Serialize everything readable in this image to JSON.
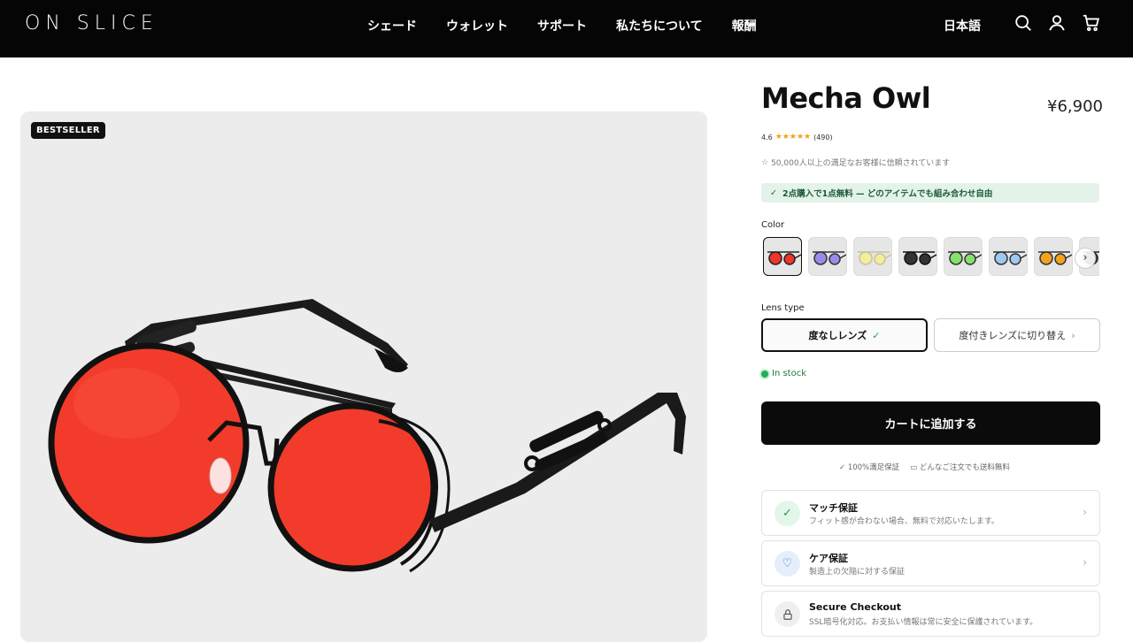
{
  "nav": {
    "logo": "ON SLICE",
    "links": [
      "シェード",
      "ウォレット",
      "サポート",
      "私たちについて",
      "報酬"
    ],
    "language": "日本語",
    "icons": [
      "search-icon",
      "account-icon",
      "cart-icon"
    ]
  },
  "gallery": {
    "badge": "BESTSELLER",
    "lens_color": "#f23b2a"
  },
  "product": {
    "title": "Mecha Owl",
    "price": "¥6,900",
    "rating": "4.6",
    "stars": "★★★★★",
    "review_count": "(490)",
    "trust": "50,000人以上の満足なお客様に信頼されています",
    "promo": "2点購入で1点無料 — どのアイテムでも組み合わせ自由",
    "color_label": "Color",
    "swatches": [
      {
        "lens": "#f0352a",
        "frame": "#222"
      },
      {
        "lens": "#9b8be8",
        "frame": "#333"
      },
      {
        "lens": "#f2ee9a",
        "frame": "#c9c1a0"
      },
      {
        "lens": "#333333",
        "frame": "#111"
      },
      {
        "lens": "#86e26c",
        "frame": "#333"
      },
      {
        "lens": "#9cc8f2",
        "frame": "#333"
      },
      {
        "lens": "#f2a21c",
        "frame": "#333"
      },
      {
        "lens": "#444444",
        "frame": "#222"
      }
    ],
    "lens_label": "Lens type",
    "lens_options": [
      "度なしレンズ",
      "度付きレンズに切り替え"
    ],
    "stock": "In stock",
    "add_to_cart": "カートに追加する",
    "assurances": [
      "100%満足保証",
      "どんなご注文でも送料無料"
    ],
    "cards": [
      {
        "title": "マッチ保証",
        "sub": "フィット感が合わない場合、無料で対応いたします。",
        "icon": "check-icon",
        "icon_bg": "#e3f6ea",
        "icon_color": "#2a9a55"
      },
      {
        "title": "ケア保証",
        "sub": "製造上の欠陥に対する保証",
        "icon": "heart-icon",
        "icon_bg": "#e6eefb",
        "icon_color": "#3c6fc8"
      },
      {
        "title": "Secure Checkout",
        "sub": "SSL暗号化対応。お支払い情報は常に安全に保護されています。",
        "icon": "lock-icon",
        "icon_bg": "#efefef",
        "icon_color": "#555"
      }
    ]
  }
}
